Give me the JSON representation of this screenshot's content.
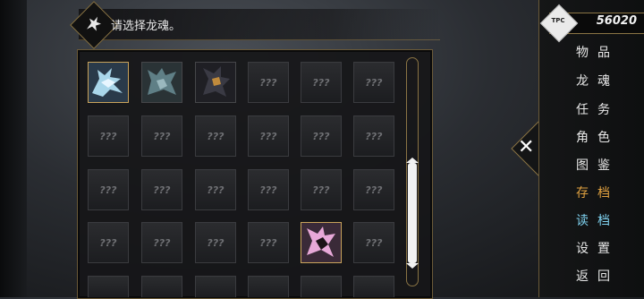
{
  "prompt": {
    "text": "请选择龙魂。"
  },
  "currency": {
    "badge_label": "TPC",
    "value": "56020"
  },
  "grid": {
    "rows": [
      [
        {
          "state": "filled",
          "label": ""
        },
        {
          "state": "dim",
          "label": ""
        },
        {
          "state": "dim",
          "label": ""
        },
        {
          "state": "locked",
          "label": "???"
        },
        {
          "state": "locked",
          "label": "???"
        },
        {
          "state": "locked",
          "label": "???"
        }
      ],
      [
        {
          "state": "locked",
          "label": "???"
        },
        {
          "state": "locked",
          "label": "???"
        },
        {
          "state": "locked",
          "label": "???"
        },
        {
          "state": "locked",
          "label": "???"
        },
        {
          "state": "locked",
          "label": "???"
        },
        {
          "state": "locked",
          "label": "???"
        }
      ],
      [
        {
          "state": "locked",
          "label": "???"
        },
        {
          "state": "locked",
          "label": "???"
        },
        {
          "state": "locked",
          "label": "???"
        },
        {
          "state": "locked",
          "label": "???"
        },
        {
          "state": "locked",
          "label": "???"
        },
        {
          "state": "locked",
          "label": "???"
        }
      ],
      [
        {
          "state": "locked",
          "label": "???"
        },
        {
          "state": "locked",
          "label": "???"
        },
        {
          "state": "locked",
          "label": "???"
        },
        {
          "state": "locked",
          "label": "???"
        },
        {
          "state": "filled",
          "label": ""
        },
        {
          "state": "locked",
          "label": "???"
        }
      ]
    ]
  },
  "menu": {
    "items": [
      {
        "label": "物品"
      },
      {
        "label": "龙魂"
      },
      {
        "label": "任务"
      },
      {
        "label": "角色"
      },
      {
        "label": "图鉴"
      },
      {
        "label": "存档"
      },
      {
        "label": "读档"
      },
      {
        "label": "设置"
      },
      {
        "label": "返回"
      }
    ]
  },
  "close": {
    "glyph": "✕"
  },
  "colors": {
    "accent_gold": "#c9a35b",
    "save_orange": "#e0a140",
    "load_cyan": "#7fd2f0"
  }
}
